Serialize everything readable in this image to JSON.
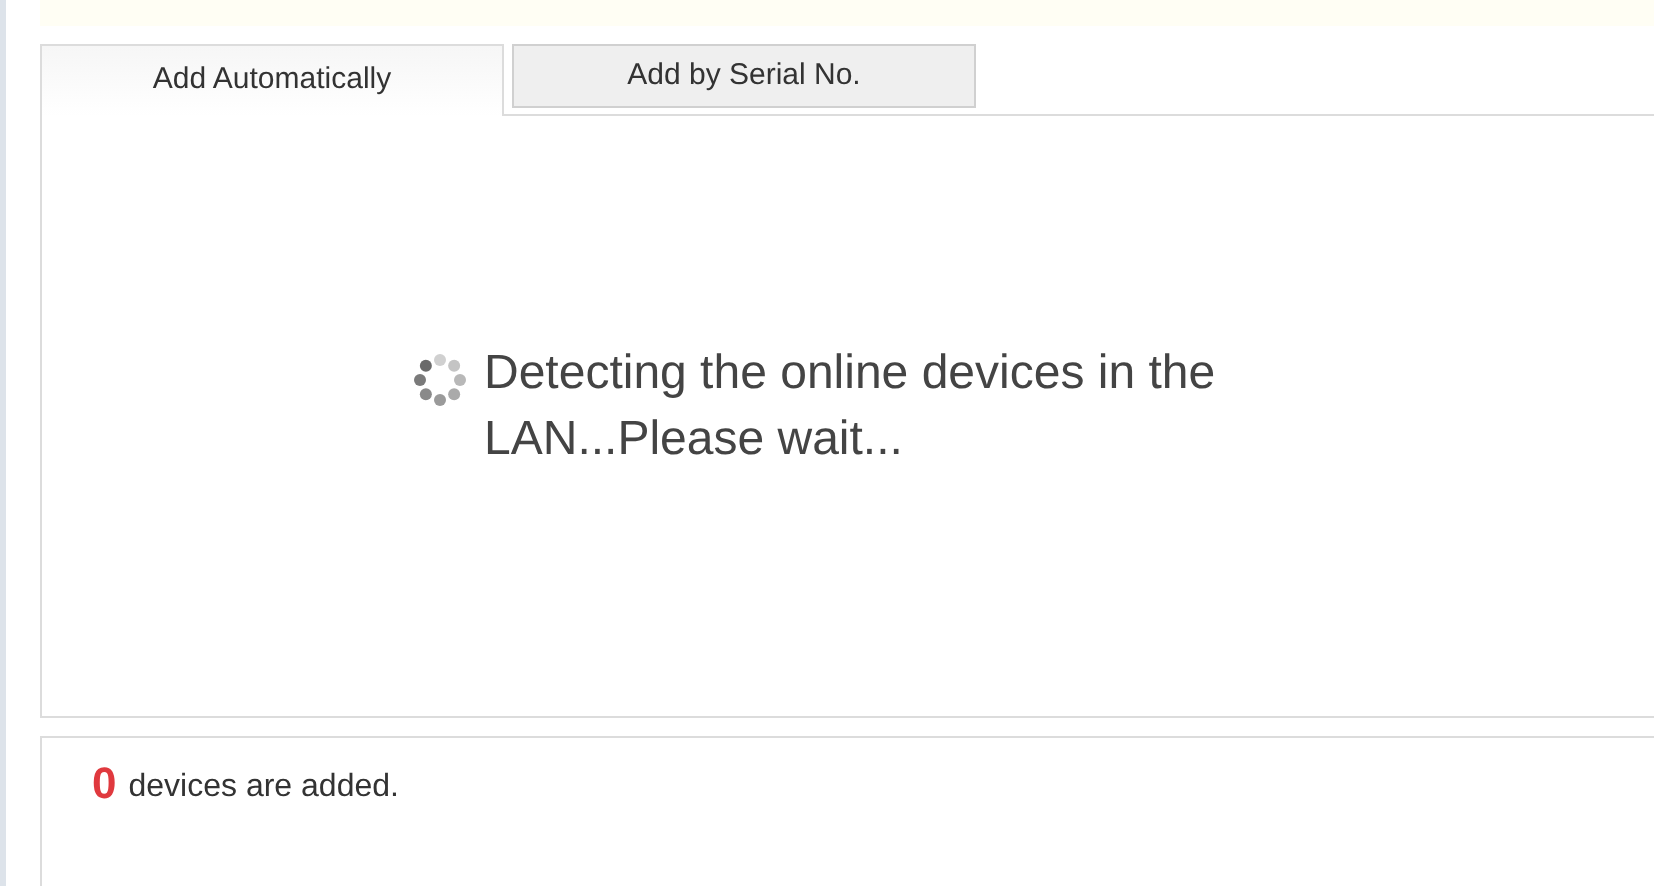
{
  "tabs": [
    {
      "label": "Add Automatically",
      "selected": true
    },
    {
      "label": "Add by Serial No.",
      "selected": false
    }
  ],
  "status": {
    "message": "Detecting the online devices in the LAN...Please wait..."
  },
  "footer": {
    "count": "0",
    "text": "devices are added."
  }
}
